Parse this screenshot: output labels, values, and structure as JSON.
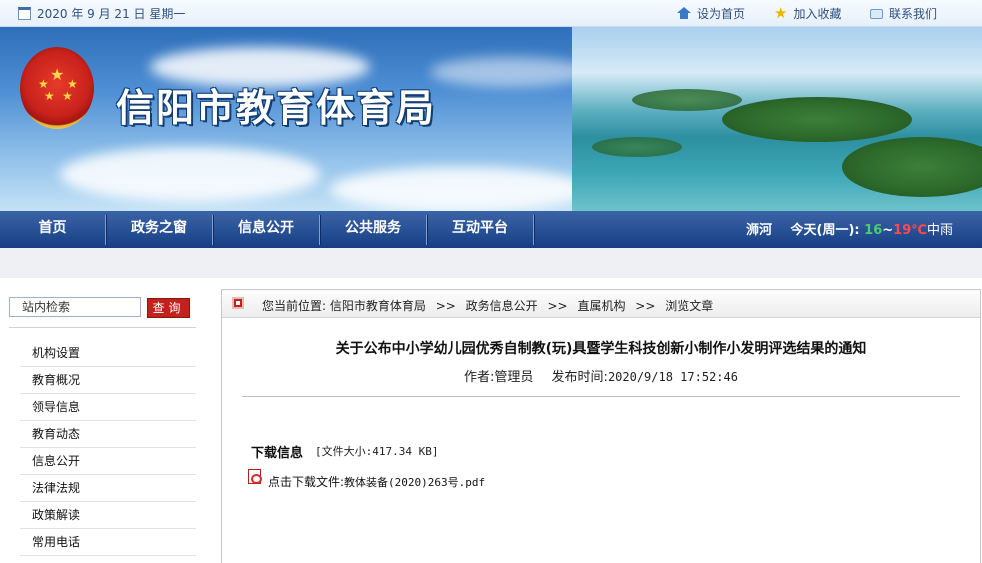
{
  "topbar": {
    "date": "2020 年 9 月 21 日 星期一",
    "set_home": "设为首页",
    "add_favorite": "加入收藏",
    "contact_us": "联系我们"
  },
  "banner": {
    "site_title": "信阳市教育体育局"
  },
  "nav": {
    "items": [
      "首页",
      "政务之窗",
      "信息公开",
      "公共服务",
      "互动平台"
    ],
    "weather": {
      "city": "浉河",
      "today": "今天(周一):",
      "low": "16",
      "separator": "~",
      "high": "19℃",
      "condition": "中雨",
      "low_color": "#49d06a",
      "high_color": "#ff4b4b"
    }
  },
  "sidebar": {
    "search_placeholder": "站内检索",
    "search_button": "查询",
    "menu": [
      "机构设置",
      "教育概况",
      "领导信息",
      "教育动态",
      "信息公开",
      "法律法规",
      "政策解读",
      "常用电话"
    ]
  },
  "breadcrumb": {
    "prefix": "您当前位置:",
    "items": [
      "信阳市教育体育局",
      "政务信息公开",
      "直属机构",
      "浏览文章"
    ],
    "separator": ">>"
  },
  "article": {
    "title": "关于公布中小学幼儿园优秀自制教(玩)具暨学生科技创新小制作小发明评选结果的通知",
    "author_label": "作者:",
    "author": "管理员",
    "published_label": "发布时间:",
    "published": "2020/9/18 17:52:46"
  },
  "download": {
    "label": "下载信息",
    "size": "[文件大小:417.34 KB]",
    "link_prefix": "点击下载文件:",
    "file_name": "教体装备(2020)263号.pdf"
  },
  "icons": {
    "date": "calendar-icon",
    "home": "home-icon",
    "favorite": "star-icon",
    "contact": "contact-icon",
    "breadcrumb": "location-icon",
    "file": "pdf-icon"
  },
  "colors": {
    "nav_bg": "#173e84",
    "search_button": "#c1231c"
  }
}
